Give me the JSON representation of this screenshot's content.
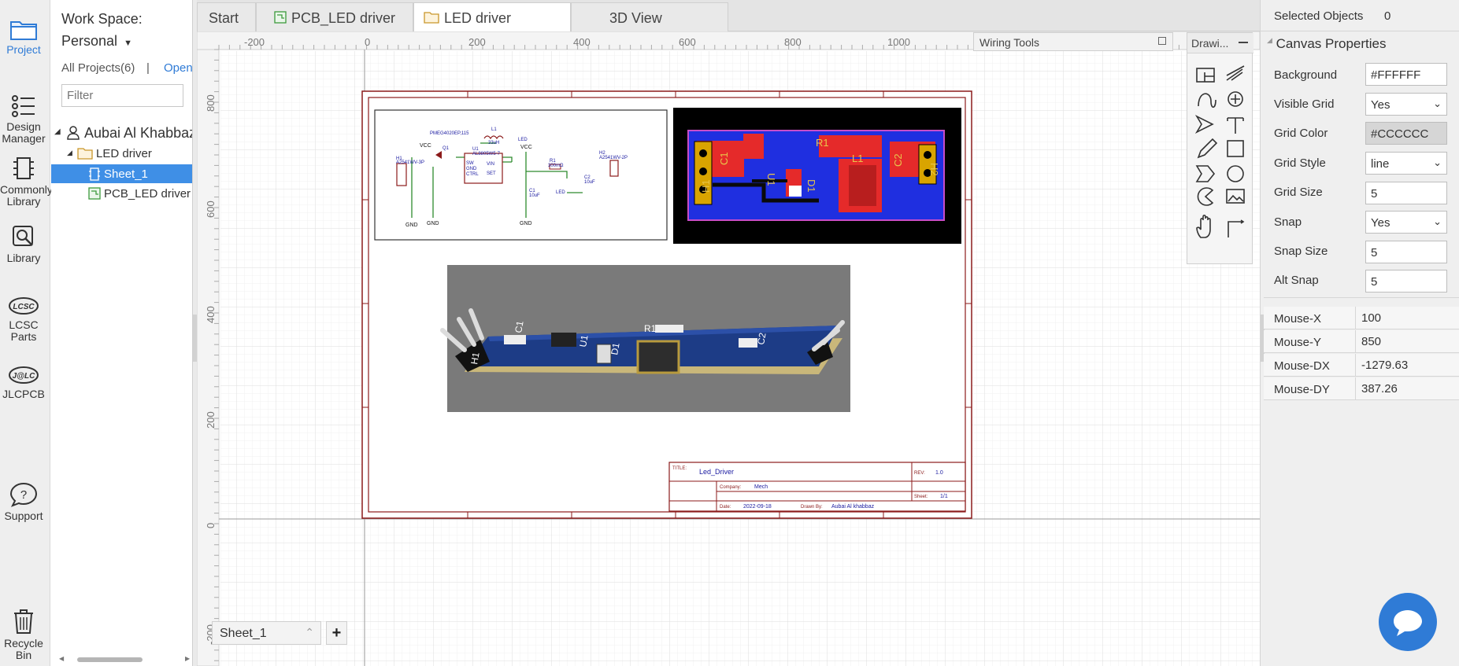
{
  "rail": {
    "project": "Project",
    "design_manager": "Design Manager",
    "commonly_library": "Commonly Library",
    "library": "Library",
    "lcsc_parts": "LCSC Parts",
    "jlcpcb": "JLCPCB",
    "support": "Support",
    "recycle_bin": "Recycle Bin"
  },
  "project_panel": {
    "workspace_label": "Work Space:",
    "workspace_value": "Personal",
    "all_projects": "All Projects(6)",
    "sep": "|",
    "open": "Open",
    "filter_placeholder": "Filter",
    "tree": {
      "owner": "Aubai Al Khabbaz",
      "project": "LED driver",
      "sheet": "Sheet_1",
      "pcb": "PCB_LED driver"
    }
  },
  "tabs": [
    {
      "label": "Start"
    },
    {
      "label": "PCB_LED driver"
    },
    {
      "label": "LED driver"
    },
    {
      "label": "3D View"
    }
  ],
  "ruler": {
    "top_labels": [
      "-200",
      "0",
      "200",
      "400",
      "600",
      "800",
      "1000"
    ],
    "left_labels": [
      "800",
      "600",
      "400",
      "200",
      "0",
      "-200"
    ]
  },
  "wiring_tools": {
    "title": "Wiring Tools"
  },
  "drawing_tools": {
    "title": "Drawi..."
  },
  "title_block": {
    "title_label": "TITLE:",
    "title_value": "Led_Driver",
    "rev_label": "REV:",
    "rev_value": "1.0",
    "company_label": "Company:",
    "company_value": "Mech",
    "sheet_label": "Sheet:",
    "sheet_value": "1/1",
    "date_label": "Date:",
    "date_value": "2022-09-18",
    "drawn_label": "Drawn By:",
    "drawn_value": "Aubai Al khabbaz"
  },
  "schematic": {
    "part_top": "PMEG4020EP,115",
    "l1": "L1",
    "l1_val": "33uH",
    "led": "LED",
    "vcc1": "VCC",
    "vcc2": "VCC",
    "q1": "Q1",
    "u1": "U1",
    "u1_part": "AL8805W5-7",
    "r1": "R1",
    "r1_val": "300mΩ",
    "h1": "H1",
    "h1_part": "A2541WV-3P",
    "h2": "H2",
    "h2_part": "A2541WV-2P",
    "sw": "SW",
    "gnd": "GND",
    "ctrl": "CTRL",
    "vin": "VIN",
    "set": "SET",
    "c1": "C1",
    "c1_val": "10uF",
    "c2": "C2",
    "c2_val": "10uF",
    "led2": "LED",
    "gnd_labels": [
      "GND",
      "GND",
      "GND"
    ]
  },
  "pcb_labels": [
    "C1",
    "R1",
    "L1",
    "C2",
    "H1",
    "U1",
    "D1",
    "H2"
  ],
  "model3d_labels": [
    "H1",
    "C1",
    "U1",
    "R1",
    "D1",
    "C2"
  ],
  "sheet_tab": {
    "label": "Sheet_1",
    "add": "+"
  },
  "right_panel": {
    "selected_label": "Selected Objects",
    "selected_value": "0",
    "section_title": "Canvas Properties",
    "props": [
      {
        "label": "Background",
        "value": "#FFFFFF",
        "kind": "input"
      },
      {
        "label": "Visible Grid",
        "value": "Yes",
        "kind": "select"
      },
      {
        "label": "Grid Color",
        "value": "#CCCCCC",
        "kind": "color"
      },
      {
        "label": "Grid Style",
        "value": "line",
        "kind": "select"
      },
      {
        "label": "Grid Size",
        "value": "5",
        "kind": "input"
      },
      {
        "label": "Snap",
        "value": "Yes",
        "kind": "select"
      },
      {
        "label": "Snap Size",
        "value": "5",
        "kind": "input"
      },
      {
        "label": "Alt Snap",
        "value": "5",
        "kind": "input"
      }
    ],
    "mouse": [
      {
        "label": "Mouse-X",
        "value": "100"
      },
      {
        "label": "Mouse-Y",
        "value": "850"
      },
      {
        "label": "Mouse-DX",
        "value": "-1279.63"
      },
      {
        "label": "Mouse-DY",
        "value": "387.26"
      }
    ]
  },
  "colors": {
    "accent": "#2f7bd6",
    "sheet_border": "#8b1a1a",
    "pcb_red": "#e52a2a",
    "pcb_blue": "#1f2fe0",
    "selection": "#3f8fe6"
  }
}
